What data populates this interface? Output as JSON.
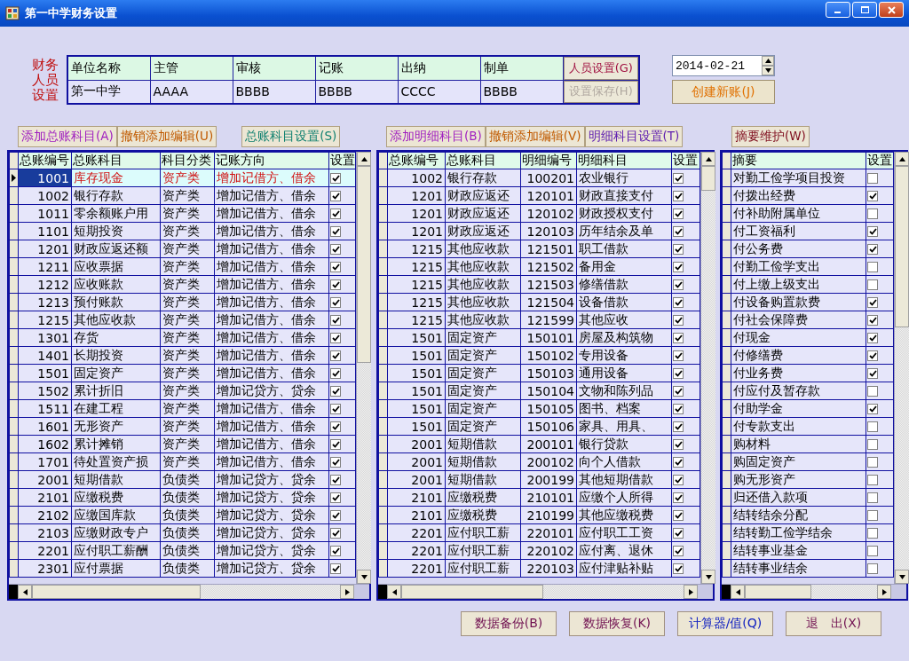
{
  "window": {
    "title": "第一中学财务设置"
  },
  "staff_setup": {
    "label": "财务人员设置",
    "columns": [
      "单位名称",
      "主管",
      "审核",
      "记账",
      "出纳",
      "制单"
    ],
    "values": [
      "第一中学",
      "AAAA",
      "BBBB",
      "BBBB",
      "CCCC",
      "BBBB"
    ],
    "buttons": [
      {
        "label": "人员设置(G)",
        "disabled": false
      },
      {
        "label": "设置保存(H)",
        "disabled": true
      }
    ]
  },
  "date_field": {
    "value": "2014-02-21"
  },
  "create_button": {
    "label": "创建新账(J)"
  },
  "panels": [
    {
      "buttons": [
        {
          "label": "添加总账科目(A)",
          "color": "#a020c0"
        },
        {
          "label": "撤销添加编辑(U)",
          "color": "#c05a00"
        },
        {
          "label": "总账科目设置(S)",
          "color": "#108070"
        }
      ],
      "columns": [
        {
          "label": "总账编号",
          "kind": "number"
        },
        {
          "label": "总账科目",
          "kind": "text"
        },
        {
          "label": "科目分类",
          "kind": "text"
        },
        {
          "label": "记账方向",
          "kind": "text"
        },
        {
          "label": "设置",
          "kind": "checkbox"
        }
      ],
      "rows": [
        {
          "cells": [
            "1001",
            "库存现金",
            "资产类",
            "增加记借方、借余"
          ],
          "checked": true,
          "selected": true
        },
        {
          "cells": [
            "1002",
            "银行存款",
            "资产类",
            "增加记借方、借余"
          ],
          "checked": true,
          "selected": false
        },
        {
          "cells": [
            "1011",
            "零余额账户用",
            "资产类",
            "增加记借方、借余"
          ],
          "checked": true,
          "selected": false
        },
        {
          "cells": [
            "1101",
            "短期投资",
            "资产类",
            "增加记借方、借余"
          ],
          "checked": true,
          "selected": false
        },
        {
          "cells": [
            "1201",
            "财政应返还额",
            "资产类",
            "增加记借方、借余"
          ],
          "checked": true,
          "selected": false
        },
        {
          "cells": [
            "1211",
            "应收票据",
            "资产类",
            "增加记借方、借余"
          ],
          "checked": true,
          "selected": false
        },
        {
          "cells": [
            "1212",
            "应收账款",
            "资产类",
            "增加记借方、借余"
          ],
          "checked": true,
          "selected": false
        },
        {
          "cells": [
            "1213",
            "预付账款",
            "资产类",
            "增加记借方、借余"
          ],
          "checked": true,
          "selected": false
        },
        {
          "cells": [
            "1215",
            "其他应收款",
            "资产类",
            "增加记借方、借余"
          ],
          "checked": true,
          "selected": false
        },
        {
          "cells": [
            "1301",
            "存货",
            "资产类",
            "增加记借方、借余"
          ],
          "checked": true,
          "selected": false
        },
        {
          "cells": [
            "1401",
            "长期投资",
            "资产类",
            "增加记借方、借余"
          ],
          "checked": true,
          "selected": false
        },
        {
          "cells": [
            "1501",
            "固定资产",
            "资产类",
            "增加记借方、借余"
          ],
          "checked": true,
          "selected": false
        },
        {
          "cells": [
            "1502",
            "累计折旧",
            "资产类",
            "增加记贷方、贷余"
          ],
          "checked": true,
          "selected": false
        },
        {
          "cells": [
            "1511",
            "在建工程",
            "资产类",
            "增加记借方、借余"
          ],
          "checked": true,
          "selected": false
        },
        {
          "cells": [
            "1601",
            "无形资产",
            "资产类",
            "增加记借方、借余"
          ],
          "checked": true,
          "selected": false
        },
        {
          "cells": [
            "1602",
            "累计摊销",
            "资产类",
            "增加记借方、借余"
          ],
          "checked": true,
          "selected": false
        },
        {
          "cells": [
            "1701",
            "待处置资产损",
            "资产类",
            "增加记借方、借余"
          ],
          "checked": true,
          "selected": false
        },
        {
          "cells": [
            "2001",
            "短期借款",
            "负债类",
            "增加记贷方、贷余"
          ],
          "checked": true,
          "selected": false
        },
        {
          "cells": [
            "2101",
            "应缴税费",
            "负债类",
            "增加记贷方、贷余"
          ],
          "checked": true,
          "selected": false
        },
        {
          "cells": [
            "2102",
            "应缴国库款",
            "负债类",
            "增加记贷方、贷余"
          ],
          "checked": true,
          "selected": false
        },
        {
          "cells": [
            "2103",
            "应缴财政专户",
            "负债类",
            "增加记贷方、贷余"
          ],
          "checked": true,
          "selected": false
        },
        {
          "cells": [
            "2201",
            "应付职工薪酬",
            "负债类",
            "增加记贷方、贷余"
          ],
          "checked": true,
          "selected": false
        },
        {
          "cells": [
            "2301",
            "应付票据",
            "负债类",
            "增加记贷方、贷余"
          ],
          "checked": true,
          "selected": false
        }
      ]
    },
    {
      "buttons": [
        {
          "label": "添加明细科目(B)",
          "color": "#a020c0"
        },
        {
          "label": "撤销添加编辑(V)",
          "color": "#c05a00"
        },
        {
          "label": "明细科目设置(T)",
          "color": "#6020b0"
        }
      ],
      "columns": [
        {
          "label": "总账编号",
          "kind": "number"
        },
        {
          "label": "总账科目",
          "kind": "text"
        },
        {
          "label": "明细编号",
          "kind": "number"
        },
        {
          "label": "明细科目",
          "kind": "text"
        },
        {
          "label": "设置",
          "kind": "checkbox"
        }
      ],
      "rows": [
        {
          "cells": [
            "1002",
            "银行存款",
            "100201",
            "农业银行"
          ],
          "checked": true
        },
        {
          "cells": [
            "1201",
            "财政应返还",
            "120101",
            "财政直接支付"
          ],
          "checked": true
        },
        {
          "cells": [
            "1201",
            "财政应返还",
            "120102",
            "财政授权支付"
          ],
          "checked": true
        },
        {
          "cells": [
            "1201",
            "财政应返还",
            "120103",
            "历年结余及单"
          ],
          "checked": true
        },
        {
          "cells": [
            "1215",
            "其他应收款",
            "121501",
            "职工借款"
          ],
          "checked": true
        },
        {
          "cells": [
            "1215",
            "其他应收款",
            "121502",
            "备用金"
          ],
          "checked": true
        },
        {
          "cells": [
            "1215",
            "其他应收款",
            "121503",
            "修缮借款"
          ],
          "checked": true
        },
        {
          "cells": [
            "1215",
            "其他应收款",
            "121504",
            "设备借款"
          ],
          "checked": true
        },
        {
          "cells": [
            "1215",
            "其他应收款",
            "121599",
            "其他应收"
          ],
          "checked": true
        },
        {
          "cells": [
            "1501",
            "固定资产",
            "150101",
            "房屋及构筑物"
          ],
          "checked": true
        },
        {
          "cells": [
            "1501",
            "固定资产",
            "150102",
            "专用设备"
          ],
          "checked": true
        },
        {
          "cells": [
            "1501",
            "固定资产",
            "150103",
            "通用设备"
          ],
          "checked": true
        },
        {
          "cells": [
            "1501",
            "固定资产",
            "150104",
            "文物和陈列品"
          ],
          "checked": true
        },
        {
          "cells": [
            "1501",
            "固定资产",
            "150105",
            "图书、档案"
          ],
          "checked": true
        },
        {
          "cells": [
            "1501",
            "固定资产",
            "150106",
            "家具、用具、"
          ],
          "checked": true
        },
        {
          "cells": [
            "2001",
            "短期借款",
            "200101",
            "银行贷款"
          ],
          "checked": true
        },
        {
          "cells": [
            "2001",
            "短期借款",
            "200102",
            "向个人借款"
          ],
          "checked": true
        },
        {
          "cells": [
            "2001",
            "短期借款",
            "200199",
            "其他短期借款"
          ],
          "checked": true
        },
        {
          "cells": [
            "2101",
            "应缴税费",
            "210101",
            "应缴个人所得"
          ],
          "checked": true
        },
        {
          "cells": [
            "2101",
            "应缴税费",
            "210199",
            "其他应缴税费"
          ],
          "checked": true
        },
        {
          "cells": [
            "2201",
            "应付职工薪",
            "220101",
            "应付职工工资"
          ],
          "checked": true
        },
        {
          "cells": [
            "2201",
            "应付职工薪",
            "220102",
            "应付离、退休"
          ],
          "checked": true
        },
        {
          "cells": [
            "2201",
            "应付职工薪",
            "220103",
            "应付津贴补贴"
          ],
          "checked": true
        }
      ]
    },
    {
      "buttons": [
        {
          "label": "摘要维护(W)",
          "color": "#801020"
        }
      ],
      "columns": [
        {
          "label": "摘要",
          "kind": "text"
        },
        {
          "label": "设置",
          "kind": "checkbox"
        }
      ],
      "rows": [
        {
          "cells": [
            "对勤工俭学项目投资"
          ],
          "checked": false
        },
        {
          "cells": [
            "付拨出经费"
          ],
          "checked": true
        },
        {
          "cells": [
            "付补助附属单位"
          ],
          "checked": false
        },
        {
          "cells": [
            "付工资福利"
          ],
          "checked": true
        },
        {
          "cells": [
            "付公务费"
          ],
          "checked": true
        },
        {
          "cells": [
            "付勤工俭学支出"
          ],
          "checked": false
        },
        {
          "cells": [
            "付上缴上级支出"
          ],
          "checked": false
        },
        {
          "cells": [
            "付设备购置款费"
          ],
          "checked": true
        },
        {
          "cells": [
            "付社会保障费"
          ],
          "checked": true
        },
        {
          "cells": [
            "付现金"
          ],
          "checked": true
        },
        {
          "cells": [
            "付修缮费"
          ],
          "checked": true
        },
        {
          "cells": [
            "付业务费"
          ],
          "checked": true
        },
        {
          "cells": [
            "付应付及暂存款"
          ],
          "checked": false
        },
        {
          "cells": [
            "付助学金"
          ],
          "checked": true
        },
        {
          "cells": [
            "付专款支出"
          ],
          "checked": false
        },
        {
          "cells": [
            "购材料"
          ],
          "checked": false
        },
        {
          "cells": [
            "购固定资产"
          ],
          "checked": false
        },
        {
          "cells": [
            "购无形资产"
          ],
          "checked": false
        },
        {
          "cells": [
            "归还借入款项"
          ],
          "checked": false
        },
        {
          "cells": [
            "结转结余分配"
          ],
          "checked": false
        },
        {
          "cells": [
            "结转勤工俭学结余"
          ],
          "checked": false
        },
        {
          "cells": [
            "结转事业基金"
          ],
          "checked": false
        },
        {
          "cells": [
            "结转事业结余"
          ],
          "checked": false
        }
      ]
    }
  ],
  "footer_buttons": [
    {
      "label": "数据备份(B)",
      "color": "#701050"
    },
    {
      "label": "数据恢复(K)",
      "color": "#701050"
    },
    {
      "label": "计算器/值(Q)",
      "color": "#1020c0"
    },
    {
      "label": "退　出(X)",
      "color": "#701050"
    }
  ]
}
